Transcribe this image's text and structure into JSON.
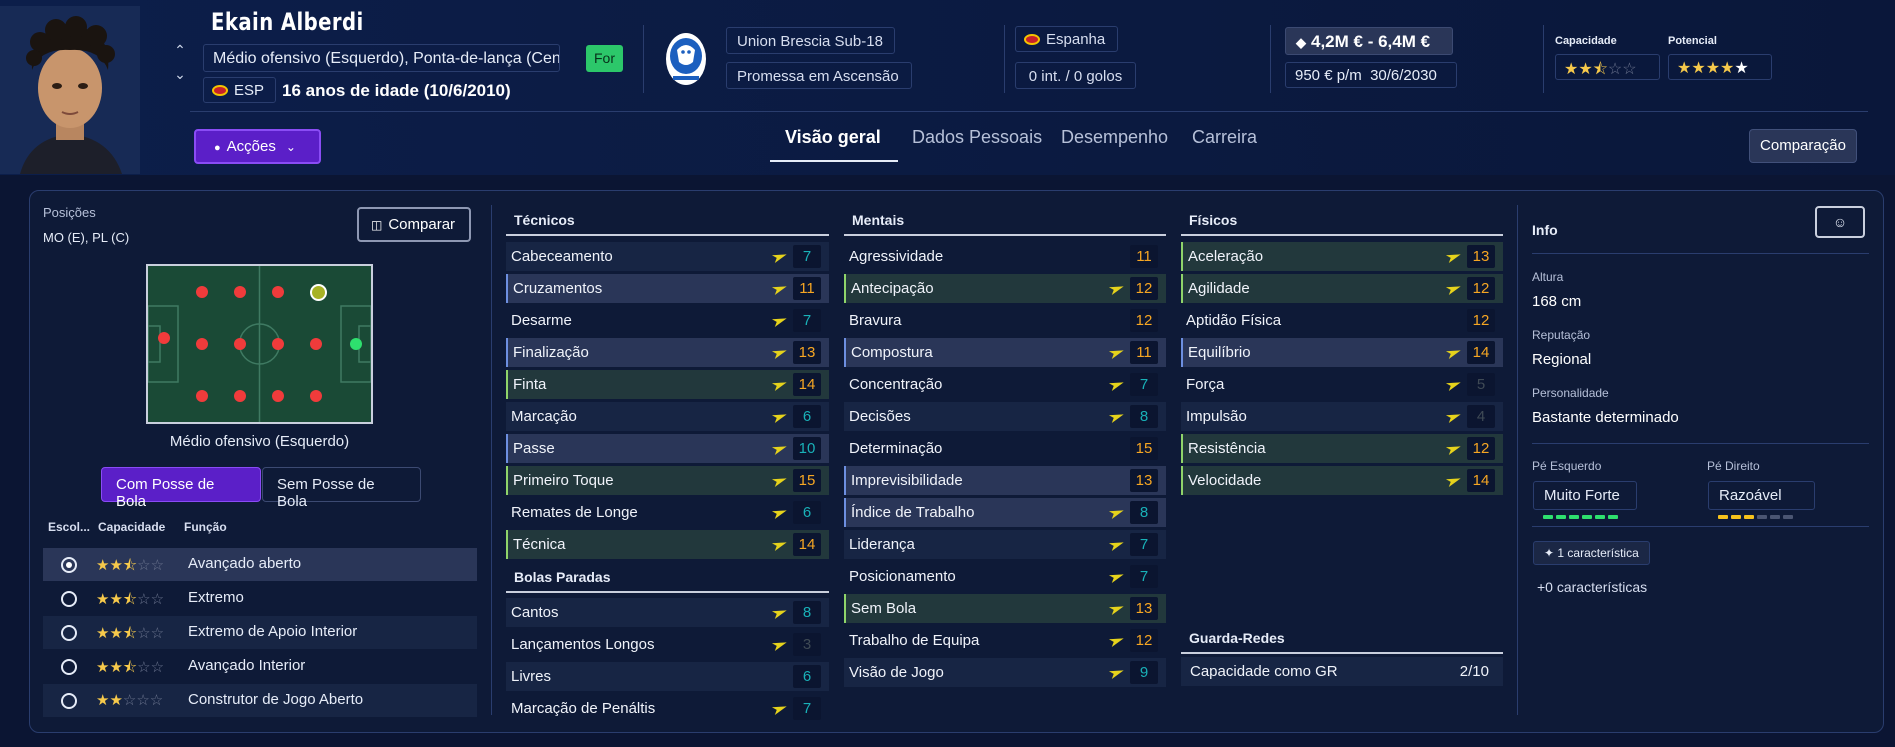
{
  "player": {
    "name": "Ekain Alberdi",
    "positions_long": "Médio ofensivo (Esquerdo), Ponta-de-lança (Cen...",
    "foot_badge": "For",
    "nationality_code": "ESP",
    "age_text": "16 anos de idade (10/6/2010)"
  },
  "club": {
    "name": "Union Brescia Sub-18",
    "status": "Promessa em Ascensão"
  },
  "country": {
    "name": "Espanha",
    "intl": "0 int. / 0 golos"
  },
  "value": {
    "range": "4,2M € - 6,4M €",
    "wage": "950 € p/m",
    "contract_end": "30/6/2030"
  },
  "ratings": {
    "capacidade_label": "Capacidade",
    "potencial_label": "Potencial",
    "capacidade_stars": 2.5,
    "potencial_stars": 4.5
  },
  "actions_label": "Acções",
  "tabs": [
    {
      "label": "Visão geral",
      "active": true
    },
    {
      "label": "Dados Pessoais",
      "active": false
    },
    {
      "label": "Desempenho",
      "active": false
    },
    {
      "label": "Carreira",
      "active": false
    }
  ],
  "comparacao_label": "Comparação",
  "positions_panel": {
    "title": "Posições",
    "short": "MO (E), PL (C)",
    "compare_label": "Comparar",
    "pitch_label": "Médio ofensivo (Esquerdo)",
    "with_ball": "Com Posse de Bola",
    "without_ball": "Sem Posse de Bola"
  },
  "roles_header": {
    "col1": "Escol...",
    "col2": "Capacidade",
    "col3": "Função"
  },
  "roles": [
    {
      "name": "Avançado aberto",
      "stars": 2.5,
      "selected": true
    },
    {
      "name": "Extremo",
      "stars": 2.5,
      "selected": false
    },
    {
      "name": "Extremo de Apoio Interior",
      "stars": 2.5,
      "selected": false
    },
    {
      "name": "Avançado Interior",
      "stars": 2.5,
      "selected": false
    },
    {
      "name": "Construtor de Jogo Aberto",
      "stars": 2,
      "selected": false
    }
  ],
  "tecnicos": {
    "title": "Técnicos",
    "attrs": [
      {
        "name": "Cabeceamento",
        "value": "7",
        "arrow": true
      },
      {
        "name": "Cruzamentos",
        "value": "11",
        "arrow": true
      },
      {
        "name": "Desarme",
        "value": "7",
        "arrow": true
      },
      {
        "name": "Finalização",
        "value": "13",
        "arrow": true
      },
      {
        "name": "Finta",
        "value": "14",
        "arrow": true
      },
      {
        "name": "Marcação",
        "value": "6",
        "arrow": true
      },
      {
        "name": "Passe",
        "value": "10",
        "arrow": true
      },
      {
        "name": "Primeiro Toque",
        "value": "15",
        "arrow": true
      },
      {
        "name": "Remates de Longe",
        "value": "6",
        "arrow": true
      },
      {
        "name": "Técnica",
        "value": "14",
        "arrow": true
      }
    ]
  },
  "bolas_paradas": {
    "title": "Bolas Paradas",
    "attrs": [
      {
        "name": "Cantos",
        "value": "8",
        "arrow": true
      },
      {
        "name": "Lançamentos Longos",
        "value": "3",
        "arrow": true
      },
      {
        "name": "Livres",
        "value": "6",
        "arrow": false
      },
      {
        "name": "Marcação de Penáltis",
        "value": "7",
        "arrow": true
      }
    ]
  },
  "mentais": {
    "title": "Mentais",
    "attrs": [
      {
        "name": "Agressividade",
        "value": "11",
        "arrow": false
      },
      {
        "name": "Antecipação",
        "value": "12",
        "arrow": true
      },
      {
        "name": "Bravura",
        "value": "12",
        "arrow": false
      },
      {
        "name": "Compostura",
        "value": "11",
        "arrow": true
      },
      {
        "name": "Concentração",
        "value": "7",
        "arrow": true
      },
      {
        "name": "Decisões",
        "value": "8",
        "arrow": true
      },
      {
        "name": "Determinação",
        "value": "15",
        "arrow": false
      },
      {
        "name": "Imprevisibilidade",
        "value": "13",
        "arrow": false
      },
      {
        "name": "Índice de Trabalho",
        "value": "8",
        "arrow": true
      },
      {
        "name": "Liderança",
        "value": "7",
        "arrow": true
      },
      {
        "name": "Posicionamento",
        "value": "7",
        "arrow": true
      },
      {
        "name": "Sem Bola",
        "value": "13",
        "arrow": true
      },
      {
        "name": "Trabalho de Equipa",
        "value": "12",
        "arrow": true
      },
      {
        "name": "Visão de Jogo",
        "value": "9",
        "arrow": true
      }
    ]
  },
  "fisicos": {
    "title": "Físicos",
    "attrs": [
      {
        "name": "Aceleração",
        "value": "13",
        "arrow": true
      },
      {
        "name": "Agilidade",
        "value": "12",
        "arrow": true
      },
      {
        "name": "Aptidão Física",
        "value": "12",
        "arrow": false
      },
      {
        "name": "Equilíbrio",
        "value": "14",
        "arrow": true
      },
      {
        "name": "Força",
        "value": "5",
        "arrow": true
      },
      {
        "name": "Impulsão",
        "value": "4",
        "arrow": true
      },
      {
        "name": "Resistência",
        "value": "12",
        "arrow": true
      },
      {
        "name": "Velocidade",
        "value": "14",
        "arrow": true
      }
    ]
  },
  "guarda_redes": {
    "title": "Guarda-Redes",
    "label": "Capacidade como GR",
    "value": "2/10"
  },
  "info": {
    "title": "Info",
    "altura_label": "Altura",
    "altura": "168 cm",
    "reputacao_label": "Reputação",
    "reputacao": "Regional",
    "personalidade_label": "Personalidade",
    "personalidade": "Bastante determinado",
    "pe_esquerdo_label": "Pé Esquerdo",
    "pe_esquerdo": "Muito Forte",
    "pe_esquerdo_level": 6,
    "pe_direito_label": "Pé Direito",
    "pe_direito": "Razoável",
    "pe_direito_level": 3,
    "caracteristica": "1 característica",
    "mais_caracteristicas": "+0 características"
  },
  "colors": {
    "accent_purple": "#5b1fc8",
    "value_teal": "#19b1b8",
    "value_amber": "#f6a623",
    "star": "#f6c94b",
    "foot_green": "#2cc76a"
  }
}
